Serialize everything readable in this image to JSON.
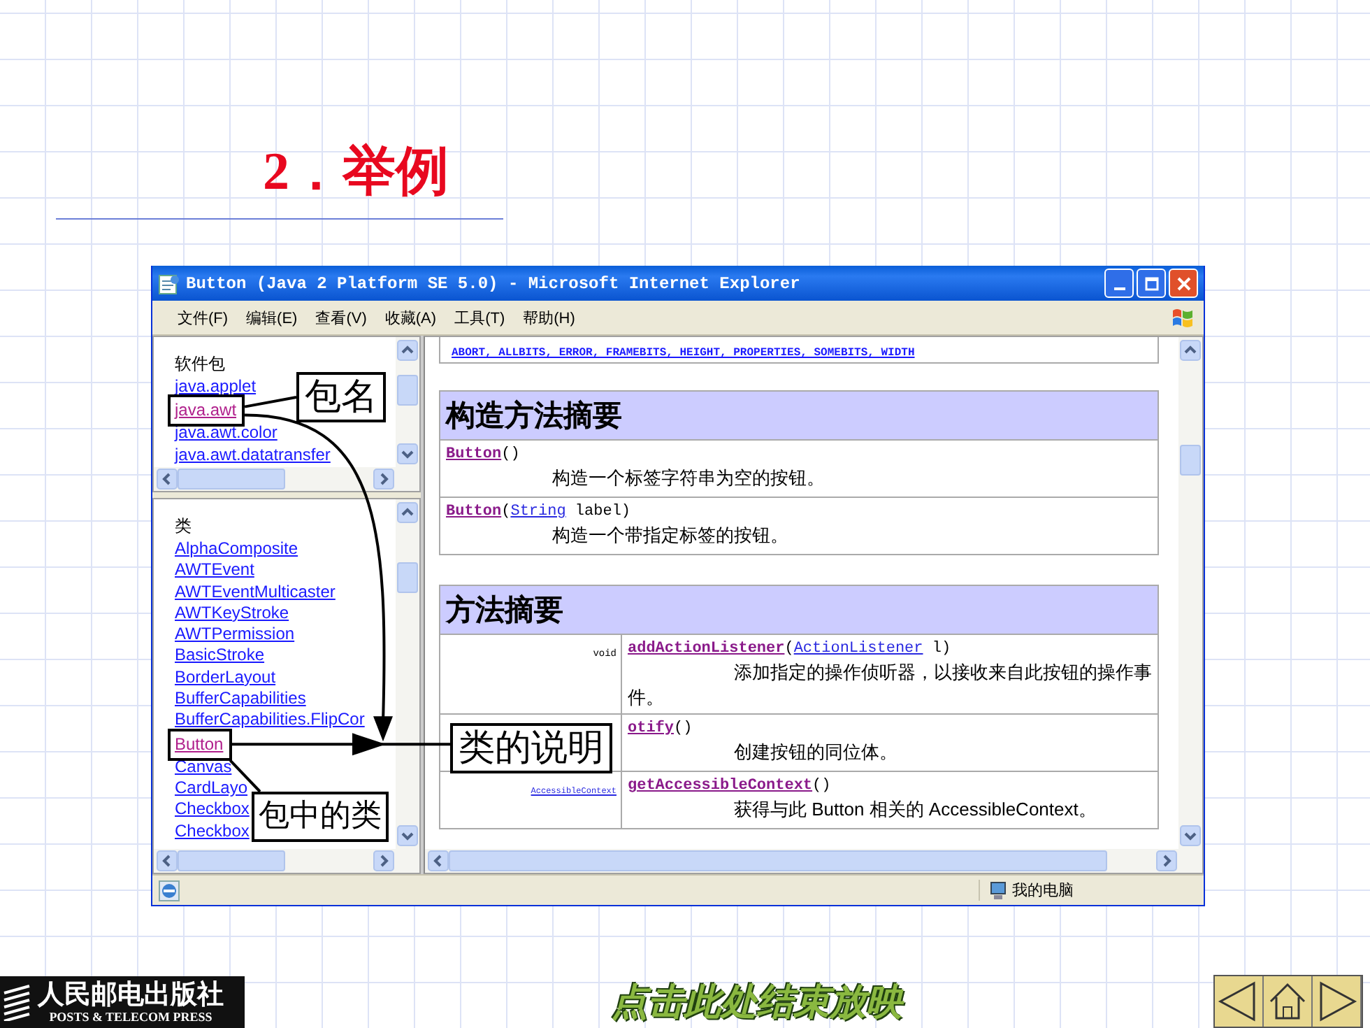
{
  "slide": {
    "title": "2．举例"
  },
  "window": {
    "title": "Button (Java 2 Platform SE 5.0) - Microsoft Internet Explorer",
    "menu": [
      "文件(F)",
      "编辑(E)",
      "查看(V)",
      "收藏(A)",
      "工具(T)",
      "帮助(H)"
    ],
    "packages": {
      "heading": "软件包",
      "items": [
        {
          "label": "java.applet",
          "visited": false,
          "framed": false
        },
        {
          "label": "java.awt",
          "visited": true,
          "framed": true
        },
        {
          "label": "java.awt.color",
          "visited": false,
          "framed": false
        },
        {
          "label": "java.awt.datatransfer",
          "visited": false,
          "framed": false
        }
      ]
    },
    "classes": {
      "heading": "类",
      "items": [
        {
          "label": "AlphaComposite",
          "visited": false,
          "framed": false
        },
        {
          "label": "AWTEvent",
          "visited": false,
          "framed": false
        },
        {
          "label": "AWTEventMulticaster",
          "visited": false,
          "framed": false
        },
        {
          "label": "AWTKeyStroke",
          "visited": false,
          "framed": false
        },
        {
          "label": "AWTPermission",
          "visited": false,
          "framed": false
        },
        {
          "label": "BasicStroke",
          "visited": false,
          "framed": false
        },
        {
          "label": "BorderLayout",
          "visited": false,
          "framed": false
        },
        {
          "label": "BufferCapabilities",
          "visited": false,
          "framed": false
        },
        {
          "label": "BufferCapabilities.FlipCor",
          "visited": false,
          "framed": false
        },
        {
          "label": "Button",
          "visited": true,
          "framed": true
        },
        {
          "label": "Canvas",
          "visited": false,
          "framed": false
        },
        {
          "label": "CardLayo",
          "visited": false,
          "framed": false
        },
        {
          "label": "Checkbox",
          "visited": false,
          "framed": false
        },
        {
          "label": "Checkbox",
          "visited": false,
          "framed": false
        }
      ]
    },
    "fields_line": "ABORT, ALLBITS, ERROR, FRAMEBITS, HEIGHT, PROPERTIES, SOMEBITS, WIDTH",
    "constructor_summary": {
      "heading": "构造方法摘要",
      "rows": [
        {
          "signature": [
            {
              "kind": "member",
              "text": "Button"
            },
            {
              "kind": "plain",
              "text": "()"
            }
          ],
          "description": "构造一个标签字符串为空的按钮。"
        },
        {
          "signature": [
            {
              "kind": "member",
              "text": "Button"
            },
            {
              "kind": "plain",
              "text": "("
            },
            {
              "kind": "type",
              "text": "String"
            },
            {
              "kind": "plain",
              "text": " label)"
            }
          ],
          "description": "构造一个带指定标签的按钮。"
        }
      ]
    },
    "method_summary": {
      "heading": "方法摘要",
      "rows": [
        {
          "type": {
            "kind": "plain",
            "text": "void"
          },
          "signature": [
            {
              "kind": "member",
              "text": "addActionListener"
            },
            {
              "kind": "plain",
              "text": "("
            },
            {
              "kind": "type",
              "text": "ActionListener"
            },
            {
              "kind": "plain",
              "text": " l)"
            }
          ],
          "description": "添加指定的操作侦听器，以接收来自此按钮的操作事件。"
        },
        {
          "signature": [
            {
              "kind": "member",
              "text": "otify"
            },
            {
              "kind": "plain",
              "text": "()"
            }
          ],
          "description": "创建按钮的同位体。"
        },
        {
          "type": {
            "kind": "type",
            "text": "AccessibleContext"
          },
          "signature": [
            {
              "kind": "member",
              "text": "getAccessibleContext"
            },
            {
              "kind": "plain",
              "text": "()"
            }
          ],
          "description": "获得与此 Button 相关的 AccessibleContext。"
        }
      ]
    },
    "status_bar": {
      "zone": "我的电脑"
    }
  },
  "callouts": [
    "包名",
    "类的说明",
    "包中的类"
  ],
  "footer": {
    "publisher": "人民邮电出版社",
    "publisher_en": "POSTS & TELECOM PRESS",
    "end_show": "点击此处结束放映"
  }
}
